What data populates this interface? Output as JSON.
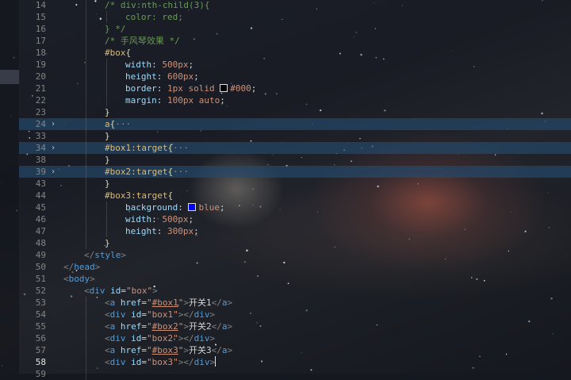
{
  "colors": {
    "swatch_black": "#000000",
    "swatch_blue": "#0000ff"
  },
  "icons": {
    "fold": "chevron-right-icon"
  },
  "editor": {
    "current_line": "58",
    "lines": [
      {
        "num": "14",
        "indent": 2,
        "tokens": [
          {
            "t": "/* div:nth-child(3){",
            "c": "comment"
          }
        ]
      },
      {
        "num": "15",
        "indent": 3,
        "tokens": [
          {
            "t": "color: red;",
            "c": "comment"
          }
        ]
      },
      {
        "num": "16",
        "indent": 2,
        "tokens": [
          {
            "t": "} */",
            "c": "comment"
          }
        ]
      },
      {
        "num": "17",
        "indent": 2,
        "tokens": [
          {
            "t": "/* 手风琴效果 */",
            "c": "comment"
          }
        ]
      },
      {
        "num": "18",
        "indent": 2,
        "tokens": [
          {
            "t": "#box",
            "c": "sel"
          },
          {
            "t": "{",
            "c": "brace"
          }
        ]
      },
      {
        "num": "19",
        "indent": 3,
        "tokens": [
          {
            "t": "width",
            "c": "prop"
          },
          {
            "t": ": ",
            "c": "text"
          },
          {
            "t": "500px",
            "c": "val"
          },
          {
            "t": ";",
            "c": "text"
          }
        ]
      },
      {
        "num": "20",
        "indent": 3,
        "tokens": [
          {
            "t": "height",
            "c": "prop"
          },
          {
            "t": ": ",
            "c": "text"
          },
          {
            "t": "600px",
            "c": "val"
          },
          {
            "t": ";",
            "c": "text"
          }
        ]
      },
      {
        "num": "21",
        "indent": 3,
        "tokens": [
          {
            "t": "border",
            "c": "prop"
          },
          {
            "t": ": ",
            "c": "text"
          },
          {
            "t": "1px solid ",
            "c": "val"
          },
          {
            "swatch": "swatch_black"
          },
          {
            "t": "#000",
            "c": "val"
          },
          {
            "t": ";",
            "c": "text"
          }
        ]
      },
      {
        "num": "22",
        "indent": 3,
        "tokens": [
          {
            "t": "margin",
            "c": "prop"
          },
          {
            "t": ": ",
            "c": "text"
          },
          {
            "t": "100px auto",
            "c": "val"
          },
          {
            "t": ";",
            "c": "text"
          }
        ]
      },
      {
        "num": "23",
        "indent": 2,
        "tokens": [
          {
            "t": "}",
            "c": "brace"
          }
        ]
      },
      {
        "num": "24",
        "indent": 2,
        "fold": true,
        "hl": true,
        "tokens": [
          {
            "t": "a",
            "c": "sel"
          },
          {
            "t": "{",
            "c": "brace"
          },
          {
            "t": "···",
            "c": "fold"
          }
        ]
      },
      {
        "num": "33",
        "indent": 2,
        "tokens": [
          {
            "t": "}",
            "c": "brace"
          }
        ]
      },
      {
        "num": "34",
        "indent": 2,
        "fold": true,
        "hl": true,
        "tokens": [
          {
            "t": "#box1:target",
            "c": "sel"
          },
          {
            "t": "{",
            "c": "brace"
          },
          {
            "t": "···",
            "c": "fold"
          }
        ]
      },
      {
        "num": "38",
        "indent": 2,
        "tokens": [
          {
            "t": "}",
            "c": "brace"
          }
        ]
      },
      {
        "num": "39",
        "indent": 2,
        "fold": true,
        "hl": true,
        "tokens": [
          {
            "t": "#box2:target",
            "c": "sel"
          },
          {
            "t": "{",
            "c": "brace"
          },
          {
            "t": "···",
            "c": "fold"
          }
        ]
      },
      {
        "num": "43",
        "indent": 2,
        "tokens": [
          {
            "t": "}",
            "c": "brace"
          }
        ]
      },
      {
        "num": "44",
        "indent": 2,
        "tokens": [
          {
            "t": "#box3:target",
            "c": "sel"
          },
          {
            "t": "{",
            "c": "brace"
          }
        ]
      },
      {
        "num": "45",
        "indent": 3,
        "tokens": [
          {
            "t": "background",
            "c": "prop"
          },
          {
            "t": ": ",
            "c": "text"
          },
          {
            "swatch": "swatch_blue"
          },
          {
            "t": "blue",
            "c": "val"
          },
          {
            "t": ";",
            "c": "text"
          }
        ]
      },
      {
        "num": "46",
        "indent": 3,
        "tokens": [
          {
            "t": "width",
            "c": "prop"
          },
          {
            "t": ": ",
            "c": "text"
          },
          {
            "t": "500px",
            "c": "val"
          },
          {
            "t": ";",
            "c": "text"
          }
        ]
      },
      {
        "num": "47",
        "indent": 3,
        "tokens": [
          {
            "t": "height",
            "c": "prop"
          },
          {
            "t": ": ",
            "c": "text"
          },
          {
            "t": "300px",
            "c": "val"
          },
          {
            "t": ";",
            "c": "text"
          }
        ]
      },
      {
        "num": "48",
        "indent": 2,
        "tokens": [
          {
            "t": "}",
            "c": "brace"
          }
        ]
      },
      {
        "num": "49",
        "indent": 1,
        "tokens": [
          {
            "t": "</",
            "c": "punc"
          },
          {
            "t": "style",
            "c": "tag"
          },
          {
            "t": ">",
            "c": "punc"
          }
        ]
      },
      {
        "num": "50",
        "indent": 0,
        "tokens": [
          {
            "t": "</",
            "c": "punc"
          },
          {
            "t": "head",
            "c": "tag"
          },
          {
            "t": ">",
            "c": "punc"
          }
        ]
      },
      {
        "num": "51",
        "indent": 0,
        "tokens": [
          {
            "t": "<",
            "c": "punc"
          },
          {
            "t": "body",
            "c": "tag"
          },
          {
            "t": ">",
            "c": "punc"
          }
        ]
      },
      {
        "num": "52",
        "indent": 1,
        "tokens": [
          {
            "t": "<",
            "c": "punc"
          },
          {
            "t": "div",
            "c": "tag"
          },
          {
            "t": " ",
            "c": "text"
          },
          {
            "t": "id",
            "c": "prop"
          },
          {
            "t": "=",
            "c": "text"
          },
          {
            "t": "\"box\"",
            "c": "val"
          },
          {
            "t": ">",
            "c": "punc"
          }
        ]
      },
      {
        "num": "53",
        "indent": 2,
        "tokens": [
          {
            "t": "<",
            "c": "punc"
          },
          {
            "t": "a",
            "c": "tag"
          },
          {
            "t": " ",
            "c": "text"
          },
          {
            "t": "href",
            "c": "prop"
          },
          {
            "t": "=",
            "c": "text"
          },
          {
            "t": "\"",
            "c": "val"
          },
          {
            "t": "#box1",
            "c": "val",
            "link": true
          },
          {
            "t": "\"",
            "c": "val"
          },
          {
            "t": ">",
            "c": "punc"
          },
          {
            "t": "开关1",
            "c": "text"
          },
          {
            "t": "</",
            "c": "punc"
          },
          {
            "t": "a",
            "c": "tag"
          },
          {
            "t": ">",
            "c": "punc"
          }
        ]
      },
      {
        "num": "54",
        "indent": 2,
        "tokens": [
          {
            "t": "<",
            "c": "punc"
          },
          {
            "t": "div",
            "c": "tag"
          },
          {
            "t": " ",
            "c": "text"
          },
          {
            "t": "id",
            "c": "prop"
          },
          {
            "t": "=",
            "c": "text"
          },
          {
            "t": "\"box1\"",
            "c": "val"
          },
          {
            "t": "></",
            "c": "punc"
          },
          {
            "t": "div",
            "c": "tag"
          },
          {
            "t": ">",
            "c": "punc"
          }
        ]
      },
      {
        "num": "55",
        "indent": 2,
        "tokens": [
          {
            "t": "<",
            "c": "punc"
          },
          {
            "t": "a",
            "c": "tag"
          },
          {
            "t": " ",
            "c": "text"
          },
          {
            "t": "href",
            "c": "prop"
          },
          {
            "t": "=",
            "c": "text"
          },
          {
            "t": "\"",
            "c": "val"
          },
          {
            "t": "#box2",
            "c": "val",
            "link": true
          },
          {
            "t": "\"",
            "c": "val"
          },
          {
            "t": ">",
            "c": "punc"
          },
          {
            "t": "开关2",
            "c": "text"
          },
          {
            "t": "</",
            "c": "punc"
          },
          {
            "t": "a",
            "c": "tag"
          },
          {
            "t": ">",
            "c": "punc"
          }
        ]
      },
      {
        "num": "56",
        "indent": 2,
        "tokens": [
          {
            "t": "<",
            "c": "punc"
          },
          {
            "t": "div",
            "c": "tag"
          },
          {
            "t": " ",
            "c": "text"
          },
          {
            "t": "id",
            "c": "prop"
          },
          {
            "t": "=",
            "c": "text"
          },
          {
            "t": "\"box2\"",
            "c": "val"
          },
          {
            "t": "></",
            "c": "punc"
          },
          {
            "t": "div",
            "c": "tag"
          },
          {
            "t": ">",
            "c": "punc"
          }
        ]
      },
      {
        "num": "57",
        "indent": 2,
        "tokens": [
          {
            "t": "<",
            "c": "punc"
          },
          {
            "t": "a",
            "c": "tag"
          },
          {
            "t": " ",
            "c": "text"
          },
          {
            "t": "href",
            "c": "prop"
          },
          {
            "t": "=",
            "c": "text"
          },
          {
            "t": "\"",
            "c": "val"
          },
          {
            "t": "#box3",
            "c": "val",
            "link": true
          },
          {
            "t": "\"",
            "c": "val"
          },
          {
            "t": ">",
            "c": "punc"
          },
          {
            "t": "开关3",
            "c": "text"
          },
          {
            "t": "</",
            "c": "punc"
          },
          {
            "t": "a",
            "c": "tag"
          },
          {
            "t": ">",
            "c": "punc"
          }
        ]
      },
      {
        "num": "58",
        "indent": 2,
        "cursor": true,
        "tokens": [
          {
            "t": "<",
            "c": "punc"
          },
          {
            "t": "div",
            "c": "tag"
          },
          {
            "t": " ",
            "c": "text"
          },
          {
            "t": "id",
            "c": "prop"
          },
          {
            "t": "=",
            "c": "text"
          },
          {
            "t": "\"box3\"",
            "c": "val"
          },
          {
            "t": "></",
            "c": "punc"
          },
          {
            "t": "div",
            "c": "tag"
          },
          {
            "t": ">",
            "c": "punc"
          }
        ]
      },
      {
        "num": "59",
        "indent": 2,
        "tokens": []
      }
    ]
  }
}
